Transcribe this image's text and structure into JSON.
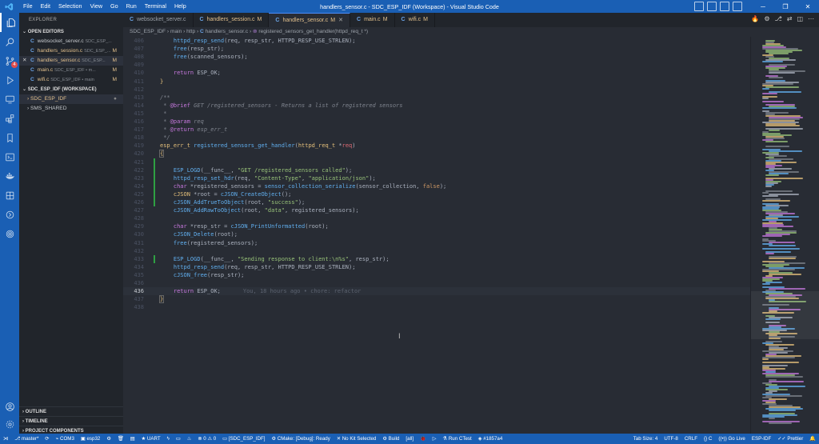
{
  "titlebar": {
    "menus": [
      "File",
      "Edit",
      "Selection",
      "View",
      "Go",
      "Run",
      "Terminal",
      "Help"
    ],
    "title": "handlers_sensor.c - SDC_ESP_IDF (Workspace) - Visual Studio Code"
  },
  "activity": {
    "icons": [
      "files-icon",
      "search-icon",
      "source-control-icon",
      "run-debug-icon",
      "remote-explorer-icon",
      "extensions-icon",
      "bookmarks-icon",
      "terminal-icon",
      "docker-icon",
      "esp-idf-icon",
      "cmake-icon",
      "fingerprint-icon"
    ],
    "scm_badge": "4",
    "bottom_icons": [
      "account-icon",
      "settings-gear-icon"
    ]
  },
  "sidebar": {
    "title": "EXPLORER",
    "open_editors_label": "OPEN EDITORS",
    "open_editors": [
      {
        "name": "websocket_server.c",
        "path": "SDC_ESP_...",
        "mod": ""
      },
      {
        "name": "handlers_session.c",
        "path": "SDC_ESP_...",
        "mod": "M"
      },
      {
        "name": "handlers_sensor.c",
        "path": "SDC_ESP...",
        "mod": "M"
      },
      {
        "name": "main.c",
        "path": "SDC_ESP_IDF • m...",
        "mod": "M"
      },
      {
        "name": "wifi.c",
        "path": "SDC_ESP_IDF • main",
        "mod": "M"
      }
    ],
    "workspace_label": "SDC_ESP_IDF (WORKSPACE)",
    "folders": [
      "SDC_ESP_IDF",
      "SMS_SHARED"
    ],
    "bottom_sections": [
      "OUTLINE",
      "TIMELINE",
      "PROJECT COMPONENTS"
    ]
  },
  "tabs": [
    {
      "name": "websocket_server.c",
      "mod": ""
    },
    {
      "name": "handlers_session.c",
      "mod": "M"
    },
    {
      "name": "handlers_sensor.c",
      "mod": "M"
    },
    {
      "name": "main.c",
      "mod": "M"
    },
    {
      "name": "wifi.c",
      "mod": "M"
    }
  ],
  "breadcrumb": {
    "parts": [
      "SDC_ESP_IDF",
      "main",
      "http"
    ],
    "file": "handlers_sensor.c",
    "symbol": "registered_sensors_get_handler(httpd_req_t *)"
  },
  "editor": {
    "blame": "You, 18 hours ago • chore: refactor"
  },
  "statusbar": {
    "left": [
      "master*",
      "COM3",
      "esp32",
      "UART",
      "0",
      "0",
      "[SDC_ESP_IDF]",
      "CMake: [Debug]: Ready",
      "No Kit Selected",
      "Build",
      "[all]",
      "Run CTest",
      "#1857a4"
    ],
    "right": [
      "Tab Size: 4",
      "UTF-8",
      "CRLF",
      "C",
      "Go Live",
      "ESP-IDF",
      "Prettier"
    ]
  },
  "colors": {
    "accent": "#1a5fb4",
    "editor_bg": "#282c34",
    "sidebar_bg": "#21252b"
  }
}
